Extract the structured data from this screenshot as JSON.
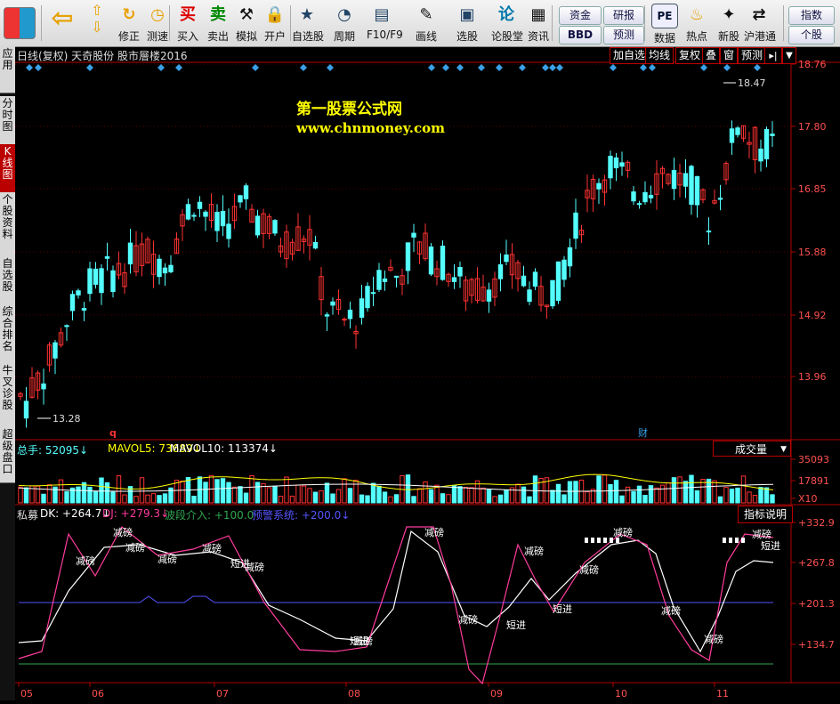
{
  "toolbar": {
    "buttons": [
      {
        "name": "back-button",
        "label": "",
        "icon": "back-arrow-icon"
      },
      {
        "name": "modify-button",
        "label": "修正",
        "icon": "refresh-icon"
      },
      {
        "name": "test-button",
        "label": "测速",
        "icon": "clock-icon"
      },
      {
        "name": "buy-button",
        "label": "买入",
        "icon": "buy-icon",
        "glyph": "买"
      },
      {
        "name": "sell-button",
        "label": "卖出",
        "icon": "sell-icon",
        "glyph": "卖"
      },
      {
        "name": "simulate-button",
        "label": "模拟",
        "icon": "hammer-icon"
      },
      {
        "name": "open-account-button",
        "label": "开户",
        "icon": "lock-icon"
      },
      {
        "name": "self-select-button",
        "label": "自选股",
        "icon": "star-icon"
      },
      {
        "name": "period-button",
        "label": "周期",
        "icon": "period-icon"
      },
      {
        "name": "f10-button",
        "label": "F10/F9",
        "icon": "f10-icon"
      },
      {
        "name": "draw-button",
        "label": "画线",
        "icon": "pen-icon"
      },
      {
        "name": "stock-pick-button",
        "label": "选股",
        "icon": "screen-icon"
      },
      {
        "name": "forum-button",
        "label": "论股堂",
        "icon": "forum-icon",
        "glyph": "论"
      },
      {
        "name": "news-button",
        "label": "资讯",
        "icon": "news-icon"
      },
      {
        "name": "data-button",
        "label": "数据",
        "icon": "pe-icon",
        "glyph": "PE"
      },
      {
        "name": "hot-button",
        "label": "热点",
        "icon": "hot-icon"
      },
      {
        "name": "ipo-button",
        "label": "新股",
        "icon": "ipo-icon"
      },
      {
        "name": "hk-button",
        "label": "沪港通",
        "icon": "hk-icon"
      }
    ],
    "pills": {
      "funds": "资金",
      "bbd": "BBD",
      "research": "研报",
      "forecast": "预测",
      "index": "指数",
      "stock": "个股"
    }
  },
  "left_tabs": [
    "应用",
    "分时图",
    "K线图",
    "个股资料",
    "自选股",
    "综合排名",
    "牛叉诊股",
    "超级盘口"
  ],
  "header": {
    "title": "日线(复权)  天奇股份  股市層楼2016",
    "buttons": [
      "加自选",
      "均线",
      "复权",
      "叠",
      "窗",
      "预测"
    ]
  },
  "watermark": {
    "line1": "第一股票公式网",
    "line2": "www.chnmoney.com"
  },
  "price_axis": [
    "18.76",
    "17.80",
    "16.85",
    "15.88",
    "14.92",
    "13.96"
  ],
  "annotations": {
    "high": "18.47",
    "low": "13.28",
    "marker_q": "q",
    "marker_cai": "财"
  },
  "volume_header": {
    "total": "总手: 52095↓",
    "mavol5": "MAVOL5: 73689↓",
    "mavol10": "MAVOL10: 113374↓",
    "button": "成交量"
  },
  "volume_axis": [
    "35093",
    "17891",
    "X10"
  ],
  "indicator_header": {
    "name": "私募",
    "dk": "DK: +264.7↓",
    "dj": "DJ: +279.3↓",
    "wave": "波段介入: +100.0",
    "alert": "预警系统: +200.0↓",
    "button": "指标说明"
  },
  "indicator_axis": [
    "+332.9",
    "+267.8",
    "+201.3",
    "+134.7"
  ],
  "indicator_labels": [
    "减磅",
    "减磅",
    "减磅",
    "减磅",
    "减磅",
    "短进",
    "减磅",
    "短进",
    "减磅",
    "短进",
    "减磅",
    "短进",
    "减磅",
    "减磅",
    "减磅",
    "减磅",
    "减磅",
    "短进",
    "减磅",
    "减磅"
  ],
  "date_axis": [
    "05",
    "06",
    "07",
    "08",
    "09",
    "10",
    "11"
  ],
  "colors": {
    "up": "#ff3232",
    "down": "#54ffff",
    "axis": "#b00000",
    "dk": "#ffffff",
    "dj": "#ff3c9c",
    "alert": "#5555ff",
    "wave": "#2fa84f",
    "yellow": "#ffff00"
  }
}
